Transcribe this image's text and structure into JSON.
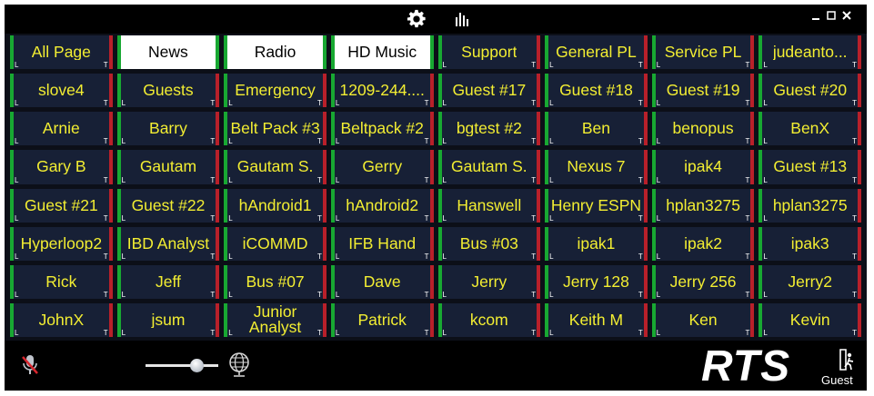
{
  "toolbar": {
    "settings_icon": "gear-icon",
    "stats_icon": "bar-chart-icon",
    "window_controls": [
      "minimize-icon",
      "restore-icon",
      "close-icon"
    ]
  },
  "markers": {
    "left": "L",
    "right": "T"
  },
  "colors": {
    "key_bg": "#172036",
    "key_text": "#f3ee32",
    "talk_green": "#18a832",
    "listen_red": "#b8202a"
  },
  "keys": [
    {
      "label": "All Page",
      "light": false
    },
    {
      "label": "News",
      "light": true
    },
    {
      "label": "Radio",
      "light": true
    },
    {
      "label": "HD Music",
      "light": true
    },
    {
      "label": "Support",
      "light": false
    },
    {
      "label": "General PL",
      "light": false
    },
    {
      "label": "Service PL",
      "light": false
    },
    {
      "label": "judeanto...",
      "light": false
    },
    {
      "label": "slove4"
    },
    {
      "label": "Guests"
    },
    {
      "label": "Emergency"
    },
    {
      "label": "1209-244...."
    },
    {
      "label": "Guest #17"
    },
    {
      "label": "Guest #18"
    },
    {
      "label": "Guest #19"
    },
    {
      "label": "Guest #20"
    },
    {
      "label": "Arnie"
    },
    {
      "label": "Barry"
    },
    {
      "label": "Belt Pack #3"
    },
    {
      "label": "Beltpack #2"
    },
    {
      "label": "bgtest #2"
    },
    {
      "label": "Ben"
    },
    {
      "label": "benopus"
    },
    {
      "label": "BenX"
    },
    {
      "label": "Gary B"
    },
    {
      "label": "Gautam"
    },
    {
      "label": "Gautam S."
    },
    {
      "label": "Gerry"
    },
    {
      "label": "Gautam S."
    },
    {
      "label": "Nexus 7"
    },
    {
      "label": "ipak4"
    },
    {
      "label": "Guest #13"
    },
    {
      "label": "Guest #21"
    },
    {
      "label": "Guest #22"
    },
    {
      "label": "hAndroid1"
    },
    {
      "label": "hAndroid2"
    },
    {
      "label": "Hanswell"
    },
    {
      "label": "Henry ESPN"
    },
    {
      "label": "hplan3275"
    },
    {
      "label": "hplan3275"
    },
    {
      "label": "Hyperloop2"
    },
    {
      "label": "IBD Analyst"
    },
    {
      "label": "iCOMMD"
    },
    {
      "label": "IFB Hand"
    },
    {
      "label": "Bus #03"
    },
    {
      "label": "ipak1"
    },
    {
      "label": "ipak2"
    },
    {
      "label": "ipak3"
    },
    {
      "label": "Rick"
    },
    {
      "label": "Jeff"
    },
    {
      "label": "Bus #07"
    },
    {
      "label": "Dave"
    },
    {
      "label": "Jerry"
    },
    {
      "label": "Jerry 128"
    },
    {
      "label": "Jerry 256"
    },
    {
      "label": "Jerry2"
    },
    {
      "label": "JohnX"
    },
    {
      "label": "jsum"
    },
    {
      "label": "Junior Analyst"
    },
    {
      "label": "Patrick"
    },
    {
      "label": "kcom"
    },
    {
      "label": "Keith M"
    },
    {
      "label": "Ken"
    },
    {
      "label": "Kevin"
    }
  ],
  "bottom": {
    "mic_icon": "muted-microphone-icon",
    "volume_level": 0.7,
    "globe_icon": "globe-icon",
    "logo_text": "RTS",
    "user_icon": "user-exit-icon",
    "user_label": "Guest"
  }
}
